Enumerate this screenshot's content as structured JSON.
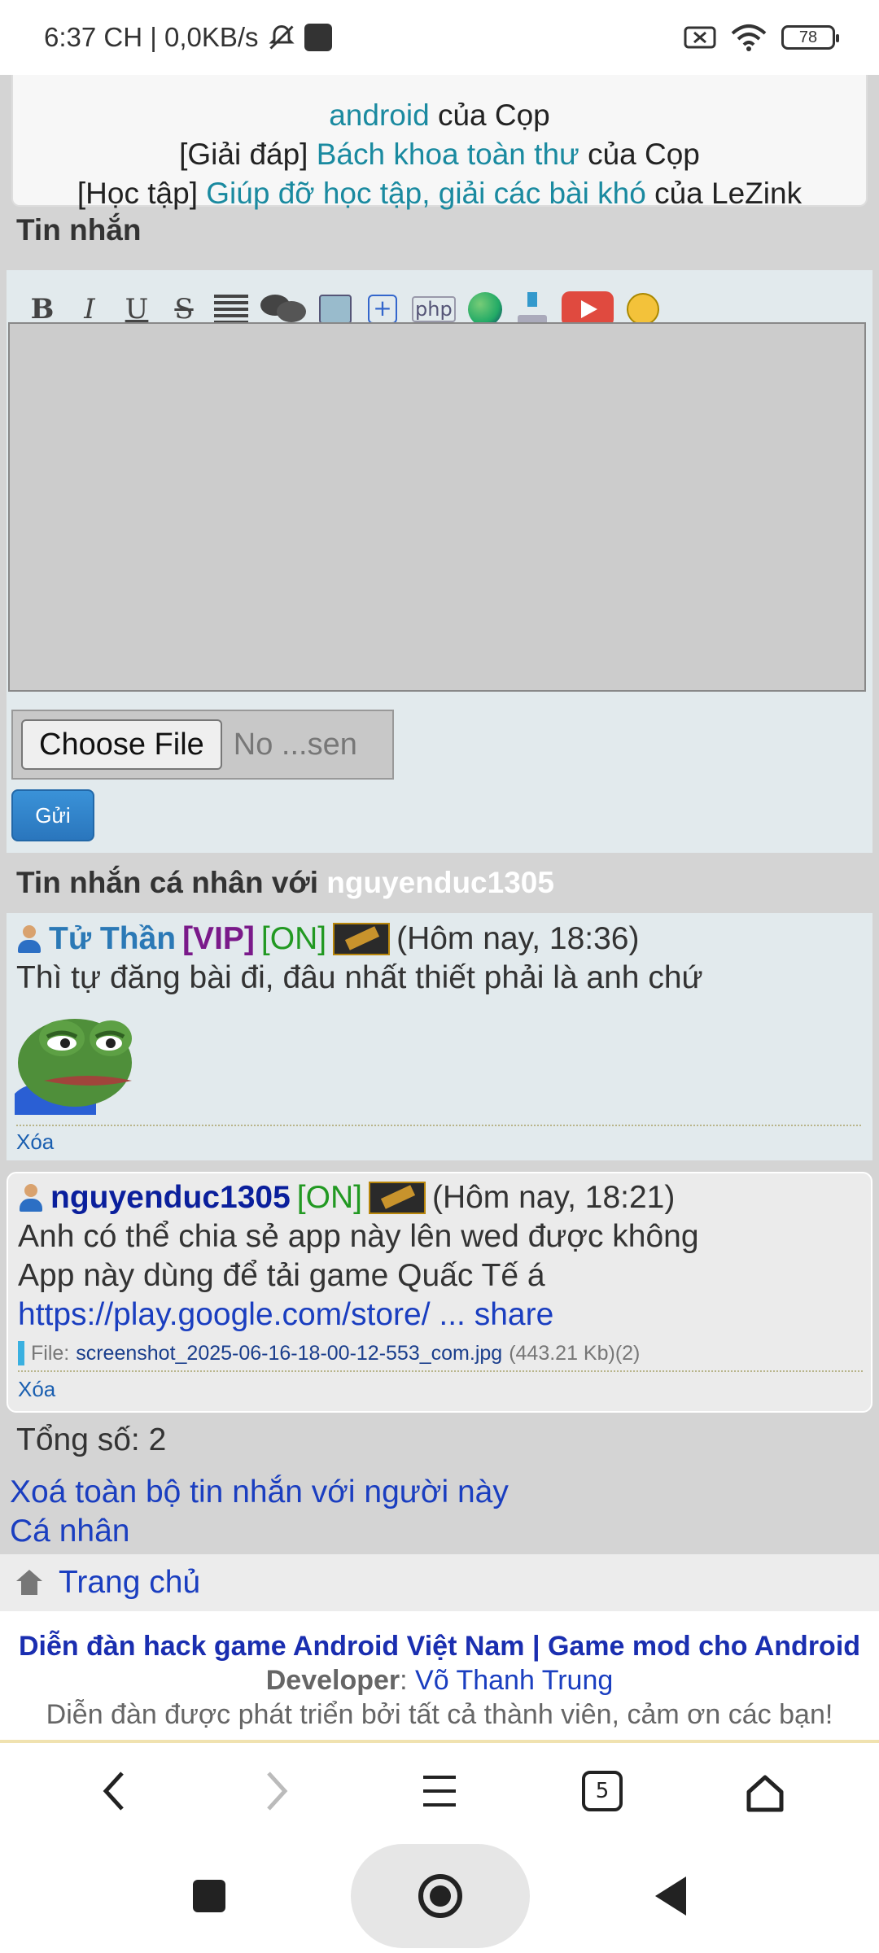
{
  "status_bar": {
    "time": "6:37 CH | 0,0KB/s",
    "battery": "78"
  },
  "links": {
    "row1_prefix": "android",
    "row1_suffix": " của Cọp",
    "row2_tag": "[Giải đáp] ",
    "row2_link": "Bách khoa toàn thư",
    "row2_suffix": " của Cọp",
    "row3_tag": "[Học tập] ",
    "row3_link": "Giúp đỡ học tập, giải các bài khó",
    "row3_suffix": " của LeZink"
  },
  "compose": {
    "title": "Tin nhắn",
    "toolbar": {
      "bold": "B",
      "italic": "I",
      "underline": "U",
      "strike": "S"
    },
    "file_button": "Choose File",
    "file_status": "No ...sen",
    "send_label": "Gửi"
  },
  "pm": {
    "title_prefix": "Tin nhắn cá nhân với ",
    "title_user": "nguyenduc1305"
  },
  "messages": [
    {
      "username": "Tử Thần",
      "vip": "[VIP]",
      "online": "[ON]",
      "time": "(Hôm nay, 18:36)",
      "text": "Thì tự đăng bài đi, đâu nhất thiết phải là anh chứ",
      "delete": "Xóa"
    },
    {
      "username": "nguyenduc1305",
      "online": "[ON]",
      "time": "(Hôm nay, 18:21)",
      "line1": "Anh có thể chia sẻ app này lên wed được không",
      "line2": "App này dùng để tải game Quấc Tế á",
      "link": "https://play.google.com/store/ ... share",
      "file_label": "File:",
      "file_name": "screenshot_2025-06-16-18-00-12-553_com.jpg",
      "file_meta": "(443.21 Kb)(2)",
      "delete": "Xóa"
    }
  ],
  "total": "Tổng số: 2",
  "actions": {
    "delete_all": "Xoá toàn bộ tin nhắn với người này",
    "personal": "Cá nhân"
  },
  "home": "Trang chủ",
  "footer": {
    "line1": "Diễn đàn hack game Android Việt Nam | Game mod cho Android",
    "dev_label": "Developer",
    "dev_name": "Võ Thanh Trung",
    "line3": "Diễn đàn được phát triển bởi tất cả thành viên, cảm ơn các bạn!"
  },
  "browser_nav": {
    "tab_count": "5"
  }
}
